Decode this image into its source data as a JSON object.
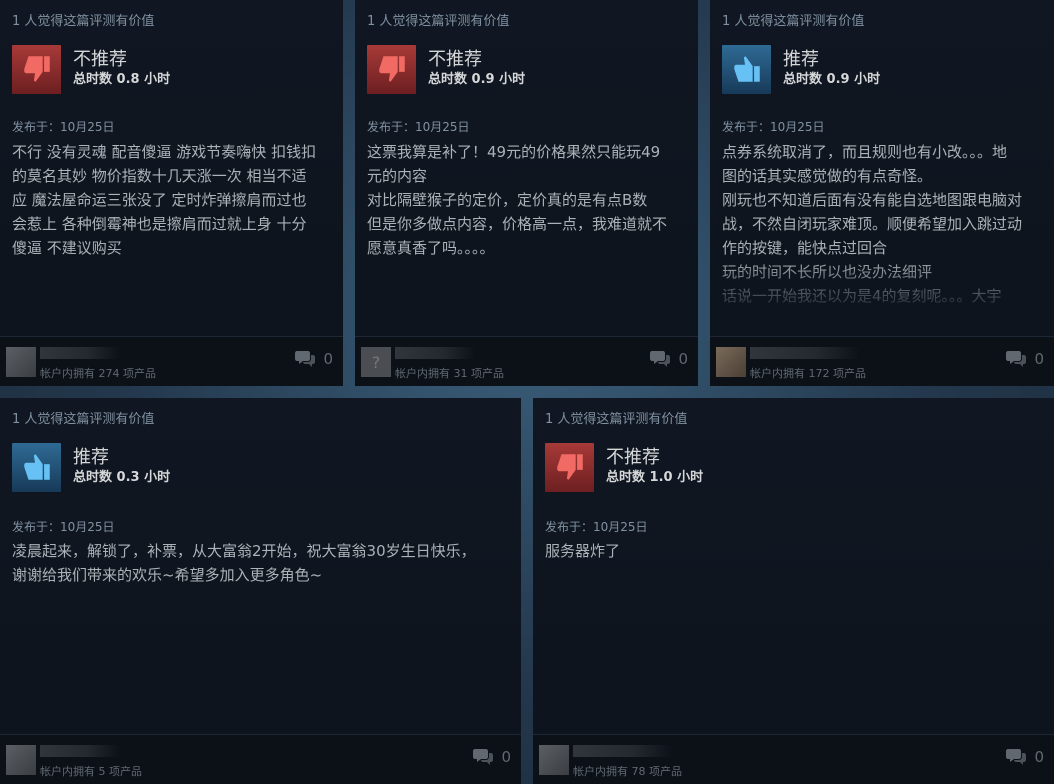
{
  "reviews": [
    {
      "helpful": "1 人觉得这篇评测有价值",
      "verdict": "不推荐",
      "thumb": "thumbs-down-icon",
      "hours": "总时数 0.8 小时",
      "posted": "发布于：10月25日",
      "body": "不行 没有灵魂 配音傻逼 游戏节奏嗨快 扣钱扣\n的莫名其妙 物价指数十几天涨一次 相当不适\n应 魔法屋命运三张没了 定时炸弹擦肩而过也\n会惹上 各种倒霉神也是擦肩而过就上身 十分\n傻逼 不建议购买",
      "owns": "帐户内拥有 274 项产品",
      "comments": "0"
    },
    {
      "helpful": "1 人觉得这篇评测有价值",
      "verdict": "不推荐",
      "thumb": "thumbs-down-icon",
      "hours": "总时数 0.9 小时",
      "posted": "发布于：10月25日",
      "body": "这票我算是补了！49元的价格果然只能玩49\n元的内容\n对比隔壁猴子的定价，定价真的是有点B数\n但是你多做点内容，价格高一点，我难道就不\n愿意真香了吗。。。。",
      "owns": "帐户内拥有 31 项产品",
      "comments": "0"
    },
    {
      "helpful": "1 人觉得这篇评测有价值",
      "verdict": "推荐",
      "thumb": "thumbs-up-icon",
      "hours": "总时数 0.9 小时",
      "posted": "发布于：10月25日",
      "body": "点券系统取消了，而且规则也有小改。。。地\n图的话其实感觉做的有点奇怪。\n刚玩也不知道后面有没有能自选地图跟电脑对\n战，不然自闭玩家难顶。顺便希望加入跳过动\n作的按键，能快点过回合\n玩的时间不长所以也没办法细评\n话说一开始我还以为是4的复刻呢。。。大宇",
      "owns": "帐户内拥有 172 项产品",
      "comments": "0"
    },
    {
      "helpful": "1 人觉得这篇评测有价值",
      "verdict": "推荐",
      "thumb": "thumbs-up-icon",
      "hours": "总时数 0.3 小时",
      "posted": "发布于：10月25日",
      "body": "凌晨起来，解锁了，补票，从大富翁2开始，祝大富翁30岁生日快乐，\n谢谢给我们带来的欢乐~希望多加入更多角色~",
      "owns": "帐户内拥有 5 项产品",
      "comments": "0"
    },
    {
      "helpful": "1 人觉得这篇评测有价值",
      "verdict": "不推荐",
      "thumb": "thumbs-down-icon",
      "hours": "总时数 1.0 小时",
      "posted": "发布于：10月25日",
      "body": "服务器炸了",
      "owns": "帐户内拥有 78 项产品",
      "comments": "0"
    }
  ],
  "colors": {
    "not_recommended": "#a73a38",
    "recommended": "#2f6a95",
    "card_bg": "#0f1520"
  }
}
